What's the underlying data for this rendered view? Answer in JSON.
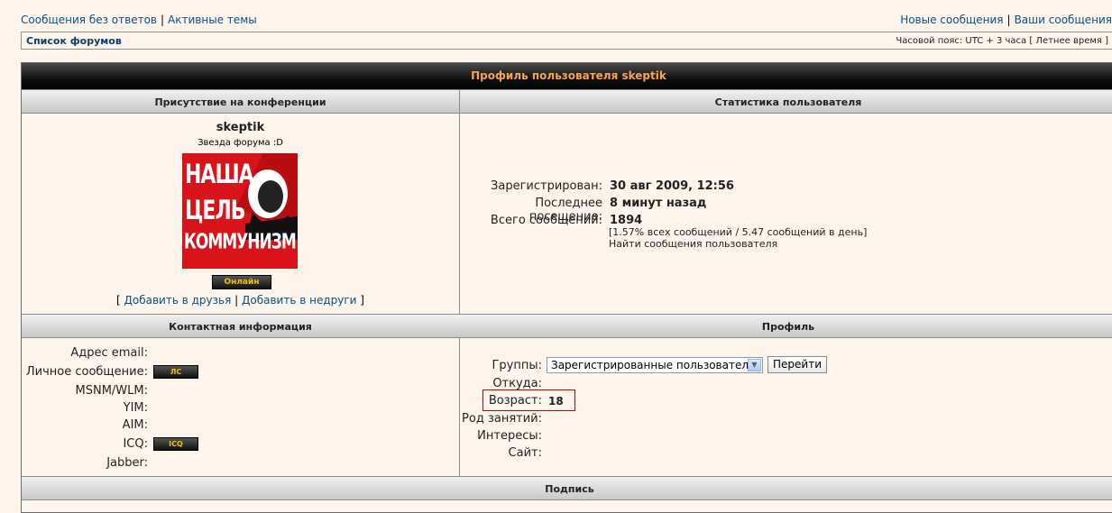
{
  "topnav": {
    "unanswered": "Сообщения без ответов",
    "active": "Активные темы",
    "new_posts": "Новые сообщения",
    "your_posts": "Ваши сообщения",
    "sep": "|"
  },
  "navbar": {
    "forum_list": "Список форумов",
    "timezone": "Часовой пояс: UTC + 3 часа [ Летнее время ]"
  },
  "profile_title": "Профиль пользователя skeptik",
  "sections": {
    "presence": "Присутствие на конференции",
    "stats": "Статистика пользователя",
    "contact": "Контактная информация",
    "profile": "Профиль",
    "signature": "Подпись"
  },
  "user": {
    "name": "skeptik",
    "rank": "Звезда форума :D",
    "avatar_lines": [
      "НАША",
      "ЦЕЛЬ",
      "КОММУНИЗМ"
    ],
    "online": "Онлайн",
    "add_friend": "Добавить в друзья",
    "add_foe": "Добавить в недруги",
    "bracket_open": "[",
    "bracket_close": "]",
    "sep": "|"
  },
  "stats": {
    "registered_label": "Зарегистрирован:",
    "registered_value": "30 авг 2009, 12:56",
    "last_visit_label": "Последнее посещение:",
    "last_visit_value": "8 минут назад",
    "posts_label": "Всего сообщений:",
    "posts_value": "1894",
    "posts_detail": "[1.57% всех сообщений / 5.47 сообщений в день]",
    "find_posts": "Найти сообщения пользователя"
  },
  "contact": {
    "email": "Адрес email:",
    "pm": "Личное сообщение:",
    "pm_button": "ЛС",
    "msnm": "MSNM/WLM:",
    "yim": "YIM:",
    "aim": "AIM:",
    "icq": "ICQ:",
    "icq_button": "ICQ",
    "jabber": "Jabber:"
  },
  "profile": {
    "groups_label": "Группы:",
    "groups_selected": "Зарегистрированные пользователи",
    "go_button": "Перейти",
    "from_label": "Откуда:",
    "age_label": "Возраст:",
    "age_value": "18",
    "occupation_label": "Род занятий:",
    "interests_label": "Интересы:",
    "site_label": "Сайт:"
  }
}
